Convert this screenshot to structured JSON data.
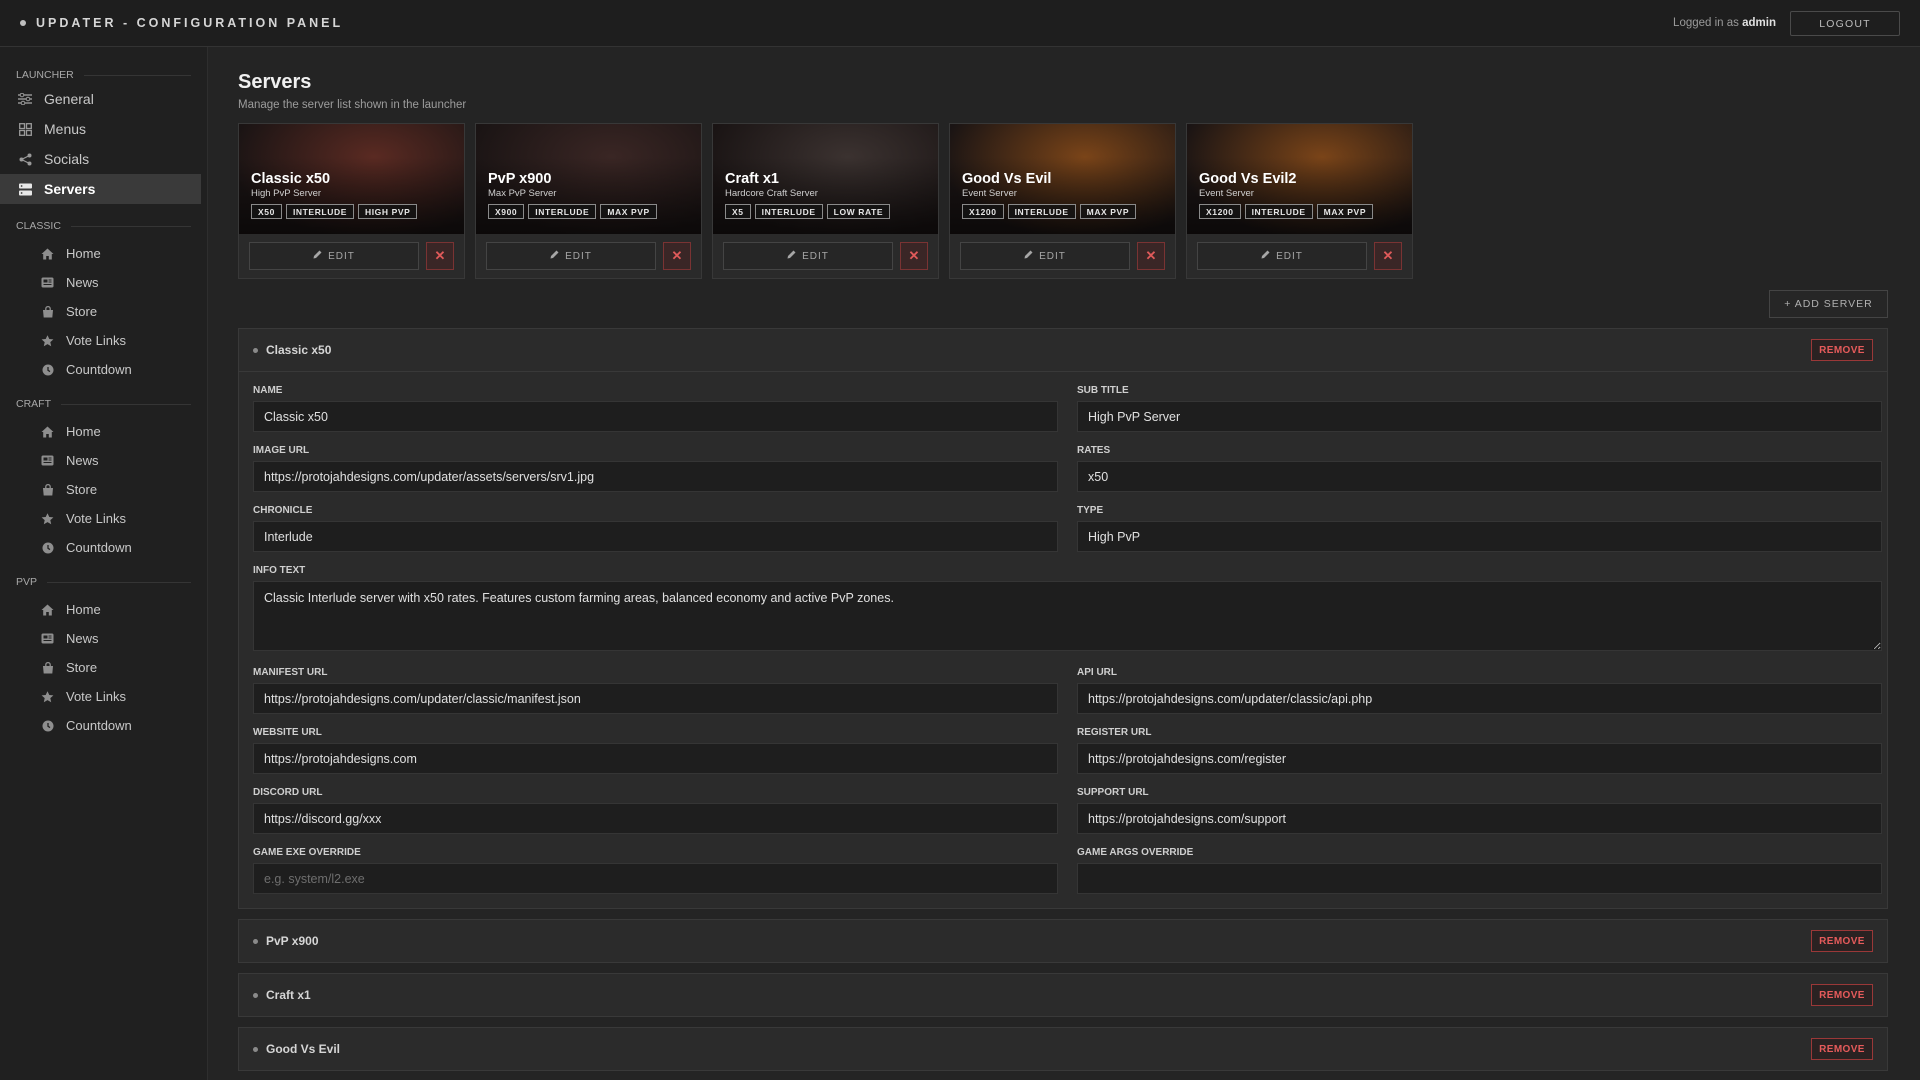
{
  "header": {
    "title": "UPDATER - CONFIGURATION PANEL",
    "logged_prefix": "Logged in as",
    "user": "admin",
    "logout_label": "LOGOUT"
  },
  "sidebar": {
    "launcher": {
      "title": "LAUNCHER",
      "items": [
        {
          "label": "General",
          "icon": "sliders-icon"
        },
        {
          "label": "Menus",
          "icon": "grid-icon"
        },
        {
          "label": "Socials",
          "icon": "share-icon"
        },
        {
          "label": "Servers",
          "icon": "server-icon",
          "active": true
        }
      ]
    },
    "groups": [
      {
        "title": "CLASSIC",
        "items": [
          "Home",
          "News",
          "Store",
          "Vote Links",
          "Countdown"
        ]
      },
      {
        "title": "CRAFT",
        "items": [
          "Home",
          "News",
          "Store",
          "Vote Links",
          "Countdown"
        ]
      },
      {
        "title": "PVP",
        "items": [
          "Home",
          "News",
          "Store",
          "Vote Links",
          "Countdown"
        ]
      }
    ]
  },
  "page": {
    "title": "Servers",
    "subtitle": "Manage the server list shown in the launcher"
  },
  "cards": [
    {
      "name": "Classic x50",
      "subtitle": "High PvP Server",
      "tags": [
        "X50",
        "INTERLUDE",
        "HIGH PVP"
      ],
      "bg": "#5a2a22"
    },
    {
      "name": "PvP x900",
      "subtitle": "Max PvP Server",
      "tags": [
        "X900",
        "INTERLUDE",
        "MAX PVP"
      ],
      "bg": "#3a2624"
    },
    {
      "name": "Craft x1",
      "subtitle": "Hardcore Craft Server",
      "tags": [
        "X5",
        "INTERLUDE",
        "LOW RATE"
      ],
      "bg": "#3b3230"
    },
    {
      "name": "Good Vs Evil",
      "subtitle": "Event Server",
      "tags": [
        "X1200",
        "INTERLUDE",
        "MAX PVP"
      ],
      "bg": "#7a4418"
    },
    {
      "name": "Good Vs Evil2",
      "subtitle": "Event Server",
      "tags": [
        "X1200",
        "INTERLUDE",
        "MAX PVP"
      ],
      "bg": "#7a4418"
    }
  ],
  "card_edit_label": "EDIT",
  "add_server_label": "+ ADD SERVER",
  "remove_label": "REMOVE",
  "expanded": {
    "title": "Classic x50",
    "fields": {
      "name_label": "NAME",
      "name_value": "Classic x50",
      "subtitle_label": "SUB TITLE",
      "subtitle_value": "High PvP Server",
      "image_label": "IMAGE URL",
      "image_value": "https://protojahdesigns.com/updater/assets/servers/srv1.jpg",
      "rates_label": "RATES",
      "rates_value": "x50",
      "chronicle_label": "CHRONICLE",
      "chronicle_value": "Interlude",
      "type_label": "TYPE",
      "type_value": "High PvP",
      "info_label": "INFO TEXT",
      "info_value": "Classic Interlude server with x50 rates. Features custom farming areas, balanced economy and active PvP zones.",
      "manifest_label": "MANIFEST URL",
      "manifest_value": "https://protojahdesigns.com/updater/classic/manifest.json",
      "api_label": "API URL",
      "api_value": "https://protojahdesigns.com/updater/classic/api.php",
      "website_label": "WEBSITE URL",
      "website_value": "https://protojahdesigns.com",
      "register_label": "REGISTER URL",
      "register_value": "https://protojahdesigns.com/register",
      "discord_label": "DISCORD URL",
      "discord_value": "https://discord.gg/xxx",
      "support_label": "SUPPORT URL",
      "support_value": "https://protojahdesigns.com/support",
      "exe_label": "GAME EXE OVERRIDE",
      "exe_placeholder": "e.g. system/l2.exe",
      "args_label": "GAME ARGS OVERRIDE",
      "args_value": ""
    }
  },
  "collapsed": [
    "PvP x900",
    "Craft x1",
    "Good Vs Evil"
  ]
}
